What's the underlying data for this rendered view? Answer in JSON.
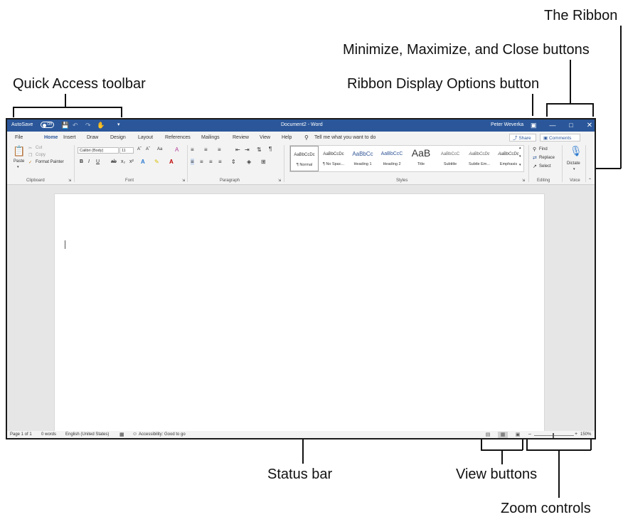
{
  "callouts": {
    "ribbon": "The Ribbon",
    "window_buttons": "Minimize, Maximize, and Close buttons",
    "quick_access": "Quick Access toolbar",
    "ribbon_display": "Ribbon Display Options button",
    "status_bar": "Status bar",
    "view_buttons": "View buttons",
    "zoom_controls": "Zoom controls"
  },
  "titlebar": {
    "autosave": "AutoSave",
    "autosave_state": "Off",
    "document_title": "Document2 - Word",
    "user": "Peter Weverka",
    "bg_color": "#2b579a"
  },
  "menu": {
    "tabs": [
      "File",
      "Home",
      "Insert",
      "Draw",
      "Design",
      "Layout",
      "References",
      "Mailings",
      "Review",
      "View",
      "Help"
    ],
    "active_tab": "Home",
    "tell_me": "Tell me what you want to do",
    "share": "Share",
    "comments": "Comments"
  },
  "ribbon": {
    "clipboard": {
      "paste": "Paste",
      "cut": "Cut",
      "copy": "Copy",
      "format_painter": "Format Painter",
      "label": "Clipboard"
    },
    "font": {
      "name": "Calibri (Body)",
      "size": "11",
      "case": "Aa",
      "bold": "B",
      "italic": "I",
      "underline": "U",
      "strike": "ab",
      "subscript": "x₂",
      "superscript": "x²",
      "label": "Font"
    },
    "paragraph": {
      "label": "Paragraph"
    },
    "styles": {
      "label": "Styles",
      "items": [
        {
          "preview": "AaBbCcDc",
          "name": "¶ Normal"
        },
        {
          "preview": "AaBbCcDc",
          "name": "¶ No Spac..."
        },
        {
          "preview": "AaBbCc",
          "name": "Heading 1"
        },
        {
          "preview": "AaBbCcC",
          "name": "Heading 2"
        },
        {
          "preview": "AaB",
          "name": "Title"
        },
        {
          "preview": "AaBbCcC",
          "name": "Subtitle"
        },
        {
          "preview": "AaBbCcDc",
          "name": "Subtle Em..."
        },
        {
          "preview": "AaBbCcDc",
          "name": "Emphasis"
        }
      ]
    },
    "editing": {
      "find": "Find",
      "replace": "Replace",
      "select": "Select",
      "label": "Editing"
    },
    "voice": {
      "dictate": "Dictate",
      "label": "Voice"
    }
  },
  "status": {
    "page": "Page 1 of 1",
    "words": "0 words",
    "language": "English (United States)",
    "accessibility": "Accessibility: Good to go",
    "zoom": "150%"
  }
}
